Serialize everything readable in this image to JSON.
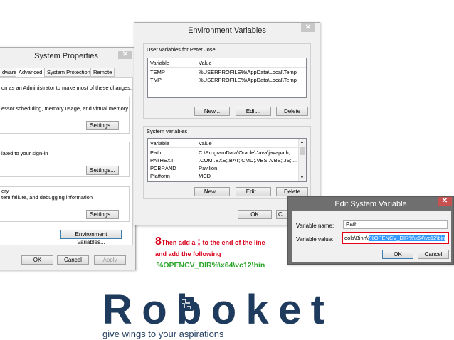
{
  "sys": {
    "title": "System Properties",
    "close": "✕",
    "tabs": [
      "dware",
      "Advanced",
      "System Protection",
      "Remote"
    ],
    "admin_note": "on as an Administrator to make most of these changes.",
    "perf_text": "essor scheduling, memory usage, and virtual memory",
    "profile_text": "lated to your sign-in",
    "startup_head": "ery",
    "startup_text": "tem failure, and debugging information",
    "settings": "Settings...",
    "env_button": "Environment Variables...",
    "ok": "OK",
    "cancel": "Cancel",
    "apply": "Apply"
  },
  "env": {
    "title": "Environment Variables",
    "close": "✕",
    "user_label": "User variables for Peter Jose",
    "col_var": "Variable",
    "col_val": "Value",
    "user_rows": [
      {
        "var": "TEMP",
        "val": "%USERPROFILE%\\AppData\\Local\\Temp"
      },
      {
        "var": "TMP",
        "val": "%USERPROFILE%\\AppData\\Local\\Temp"
      }
    ],
    "sys_label": "System variables",
    "sys_rows": [
      {
        "var": "Path",
        "val": "C:\\ProgramData\\Oracle\\Java\\javapath;..."
      },
      {
        "var": "PATHEXT",
        "val": ".COM;.EXE;.BAT;.CMD;.VBS;.VBE;.JS;...."
      },
      {
        "var": "PCBRAND",
        "val": "Pavilion"
      },
      {
        "var": "Platform",
        "val": "MCD"
      }
    ],
    "new": "New...",
    "edit": "Edit...",
    "delete": "Delete",
    "ok": "OK",
    "cancel_partial": "C"
  },
  "edit": {
    "title": "Edit System Variable",
    "close": "✕",
    "name_label": "Variable name:",
    "name_value": "Path",
    "value_label": "Variable value:",
    "value_prefix": "ools\\Binn\\;",
    "value_selected": "%OPENCV_DIR%\\x64\\vc12\\bin",
    "ok": "OK",
    "cancel": "Cancel"
  },
  "instruction": {
    "step": "8",
    "line1a": "Then add a",
    "semicolon": ";",
    "line1b": "to the end of the line",
    "line2a": "and",
    "line2b": "add the following",
    "path": "%OPENCV_DIR%\\x64\\vc12\\bin"
  },
  "brand": {
    "name": "Roboket",
    "tagline": "give wings to your aspirations",
    "color": "#1e3a5c"
  }
}
